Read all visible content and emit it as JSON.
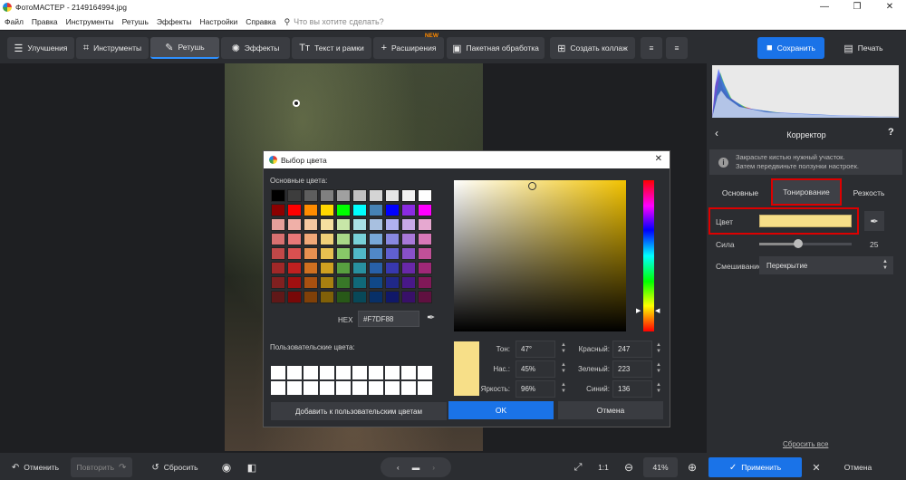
{
  "window": {
    "title": "ФотоМАСТЕР - 2149164994.jpg",
    "minimize": "—",
    "maximize": "❐",
    "close": "✕"
  },
  "menu": {
    "items": [
      "Файл",
      "Правка",
      "Инструменты",
      "Ретушь",
      "Эффекты",
      "Настройки",
      "Справка"
    ],
    "search_placeholder": "Что вы хотите сделать?"
  },
  "toolbar": {
    "improve": "Улучшения",
    "tools": "Инструменты",
    "retouch": "Ретушь",
    "effects": "Эффекты",
    "text": "Текст и рамки",
    "extensions": "Расширения",
    "new_badge": "NEW",
    "batch": "Пакетная обработка",
    "collage": "Создать коллаж",
    "save": "Сохранить",
    "print": "Печать"
  },
  "dialog": {
    "title": "Выбор цвета",
    "close": "✕",
    "basic_colors_label": "Основные цвета:",
    "custom_colors_label": "Пользовательские цвета:",
    "hex_label": "HEX",
    "hex_value": "#F7DF88",
    "add_custom": "Добавить к пользовательским цветам",
    "ok": "OK",
    "cancel": "Отмена",
    "fields": {
      "hue_label": "Тон:",
      "hue": "47°",
      "sat_label": "Нас.:",
      "sat": "45%",
      "bright_label": "Яркость:",
      "bright": "96%",
      "red_label": "Красный:",
      "red": "247",
      "green_label": "Зеленый:",
      "green": "223",
      "blue_label": "Синий:",
      "blue": "136"
    },
    "basic_colors": [
      "#000000",
      "#3d3d3d",
      "#5e5e5e",
      "#808080",
      "#a0a0a0",
      "#c0c0c0",
      "#d4d4d4",
      "#e6e6e6",
      "#f2f2f2",
      "#ffffff",
      "#8b0000",
      "#ff0000",
      "#ff8c00",
      "#ffd700",
      "#00ff00",
      "#00ffff",
      "#4682b4",
      "#0000ff",
      "#8a2be2",
      "#ff00ff",
      "#e6a09b",
      "#f0b0a8",
      "#f5c8a0",
      "#f5e0a0",
      "#c8e6a8",
      "#a8e0e6",
      "#a8c0e0",
      "#b0b0f0",
      "#c8a8e6",
      "#e6a8d0",
      "#d87070",
      "#e87878",
      "#f0a878",
      "#f0d078",
      "#a8d888",
      "#78d0d8",
      "#78a8d8",
      "#8888e0",
      "#a878d8",
      "#d878b8",
      "#c04848",
      "#d85050",
      "#e89050",
      "#e8c050",
      "#88c868",
      "#50b8c8",
      "#5088c8",
      "#6060d0",
      "#8850c8",
      "#c05098",
      "#a02828",
      "#c02020",
      "#d07020",
      "#d0a020",
      "#58a040",
      "#2890a0",
      "#2860a8",
      "#3838b0",
      "#6828a8",
      "#a02878",
      "#802020",
      "#a01010",
      "#a85010",
      "#a88010",
      "#387828",
      "#106878",
      "#104888",
      "#202888",
      "#481888",
      "#801858",
      "#601818",
      "#780808",
      "#804008",
      "#806008",
      "#285818",
      "#084858",
      "#083068",
      "#101868",
      "#381068",
      "#601040"
    ]
  },
  "panel": {
    "title": "Корректор",
    "back": "‹",
    "help": "?",
    "info_line1": "Закрасьте кистью нужный участок.",
    "info_line2": "Затем передвиньте ползунки настроек.",
    "tabs": [
      "Основные",
      "Тонирование",
      "Резкость"
    ],
    "color_label": "Цвет",
    "color_value": "#F7DF88",
    "strength_label": "Сила",
    "strength_value": "25",
    "blend_label": "Смешивание",
    "blend_value": "Перекрытие",
    "reset_all": "Сбросить все"
  },
  "bottom": {
    "undo": "Отменить",
    "redo": "Повторить",
    "reset": "Сбросить",
    "one_to_one": "1:1",
    "zoom": "41%",
    "apply": "Применить",
    "cancel": "Отмена"
  }
}
